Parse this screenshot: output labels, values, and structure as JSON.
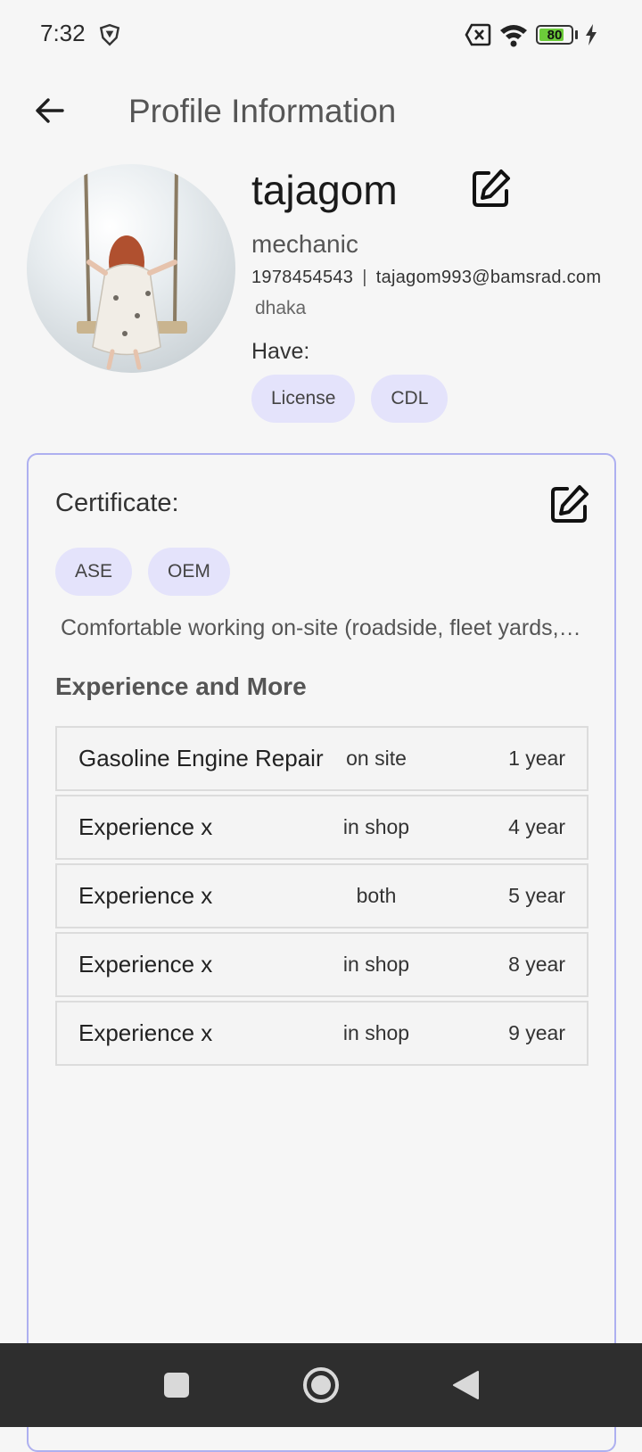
{
  "status_bar": {
    "time": "7:32",
    "battery_level": "80",
    "battery_fraction": 0.8,
    "icons": [
      "shield-icon",
      "no-sim-icon",
      "wifi-icon",
      "battery-icon",
      "charging-bolt-icon"
    ]
  },
  "app_bar": {
    "title": "Profile Information",
    "back_icon": "arrow-left-icon"
  },
  "profile": {
    "name": "tajagom",
    "role": "mechanic",
    "phone": "1978454543",
    "separator": "|",
    "email": "tajagom993@bamsrad.com",
    "city": "dhaka",
    "have_label": "Have:",
    "have_chips": [
      "License",
      "CDL"
    ],
    "edit_icon": "edit-icon"
  },
  "certificate_card": {
    "label": "Certificate:",
    "chips": [
      "ASE",
      "OEM"
    ],
    "note": "Comfortable working on-site (roadside, fleet yards, customer locations)",
    "experience_heading": "Experience and More",
    "experience": [
      {
        "name": "Gasoline Engine Repair",
        "location": "on site",
        "years": "1 year"
      },
      {
        "name": "Experience x",
        "location": "in shop",
        "years": "4 year"
      },
      {
        "name": "Experience x",
        "location": "both",
        "years": "5 year"
      },
      {
        "name": "Experience x",
        "location": "in shop",
        "years": "8 year"
      },
      {
        "name": "Experience x",
        "location": "in shop",
        "years": "9 year"
      }
    ]
  },
  "colors": {
    "chip_bg": "#e4e3fb",
    "card_border": "#aeb0f0",
    "nav_bg": "#2e2e2e",
    "battery_green": "#6ccb3a"
  },
  "nav_bar": {
    "buttons": [
      "recents-square-icon",
      "home-circle-icon",
      "back-triangle-icon"
    ]
  }
}
